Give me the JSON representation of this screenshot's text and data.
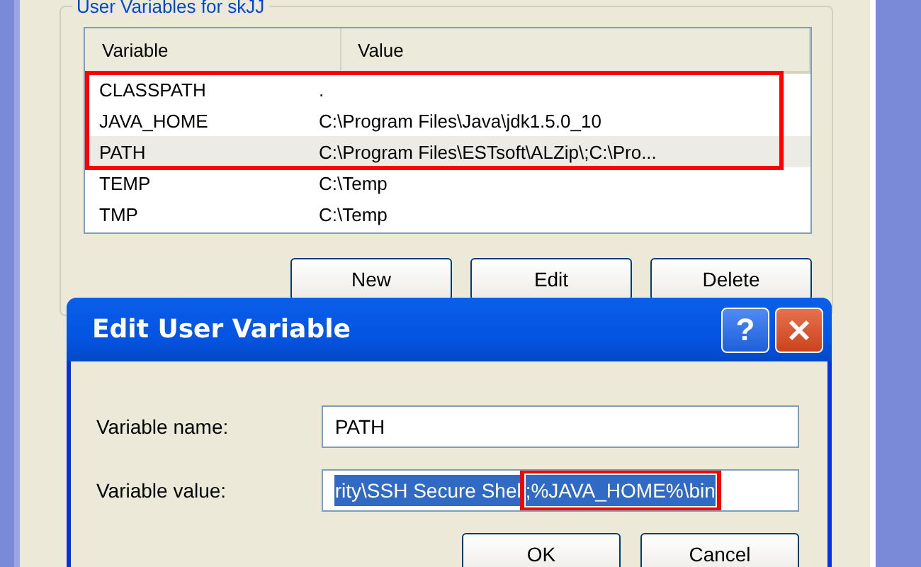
{
  "back_window": {
    "group_title": "User Variables for skJJ",
    "columns": [
      "Variable",
      "Value"
    ],
    "rows": [
      {
        "variable": "CLASSPATH",
        "value": ".",
        "selected": false,
        "highlighted": true
      },
      {
        "variable": "JAVA_HOME",
        "value": "C:\\Program Files\\Java\\jdk1.5.0_10",
        "selected": false,
        "highlighted": true
      },
      {
        "variable": "PATH",
        "value": "C:\\Program Files\\ESTsoft\\ALZip\\;C:\\Pro...",
        "selected": true,
        "highlighted": true
      },
      {
        "variable": "TEMP",
        "value": "C:\\Temp",
        "selected": false,
        "highlighted": false
      },
      {
        "variable": "TMP",
        "value": "C:\\Temp",
        "selected": false,
        "highlighted": false
      }
    ],
    "buttons": [
      "New",
      "Edit",
      "Delete"
    ]
  },
  "dialog": {
    "title": "Edit User Variable",
    "help_button": "?",
    "fields": [
      {
        "label": "Variable name:",
        "value": "PATH"
      },
      {
        "label": "Variable value:",
        "value": "rity\\SSH Secure Shel",
        "highlighted_value": ";%JAVA_HOME%\\bin"
      }
    ],
    "buttons": [
      "OK",
      "Cancel"
    ]
  }
}
